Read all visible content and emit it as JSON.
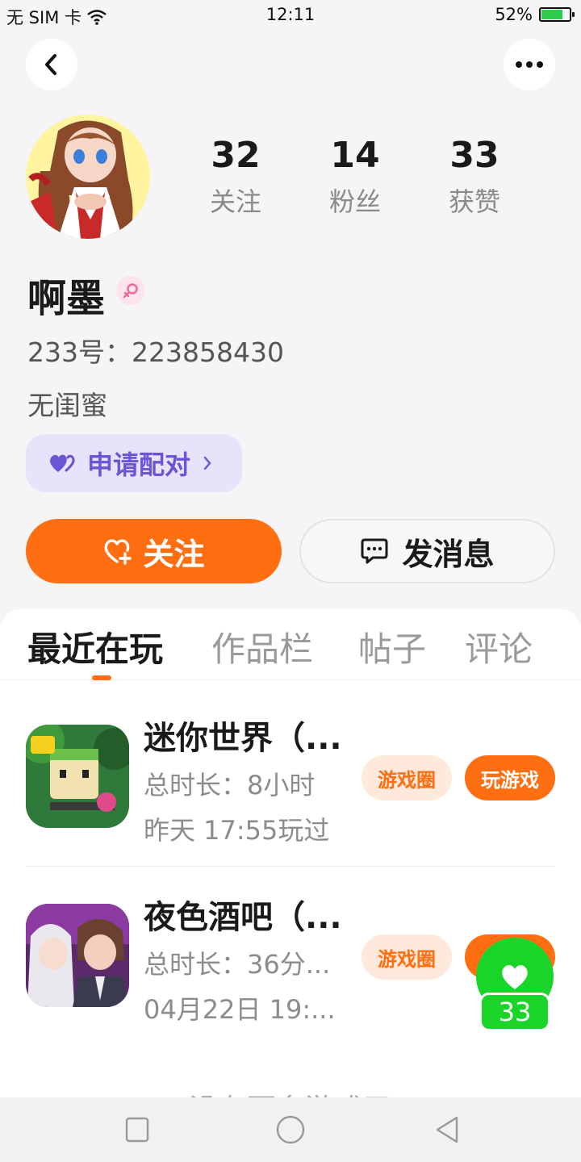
{
  "status_bar": {
    "carrier": "无 SIM 卡",
    "time": "12:11",
    "battery": "52%",
    "battery_level": 0.52,
    "icons": [
      "wifi-icon",
      "battery-icon"
    ]
  },
  "header": {
    "back_icon": "chevron-left-icon",
    "more_icon": "more-dots-icon"
  },
  "profile": {
    "avatar": "anime-girl-avatar",
    "stats": [
      {
        "value": "32",
        "label": "关注"
      },
      {
        "value": "14",
        "label": "粉丝"
      },
      {
        "value": "33",
        "label": "获赞"
      }
    ],
    "nickname": "啊墨",
    "gender_icon": "female-icon",
    "id_text": "233号：223858430",
    "bff_text": "无闺蜜",
    "pair_button": "申请配对",
    "follow_button": "关注",
    "message_button": "发消息"
  },
  "tabs": [
    {
      "label": "最近在玩",
      "active": true
    },
    {
      "label": "作品栏",
      "active": false
    },
    {
      "label": "帖子",
      "active": false
    },
    {
      "label": "评论",
      "active": false
    }
  ],
  "games": [
    {
      "title": "迷你世界（...",
      "duration": "总时长：8小时",
      "last_played": "昨天 17:55玩过",
      "circle_button": "游戏圈",
      "play_button": "玩游戏"
    },
    {
      "title": "夜色酒吧（...",
      "duration": "总时长：36分...",
      "last_played": "04月22日 19:...",
      "circle_button": "游戏圈",
      "play_button": ""
    }
  ],
  "footer_text": "没有更多游戏了",
  "floating_like": {
    "count": "33",
    "icon": "heart-icon"
  },
  "colors": {
    "accent": "#ff6f12",
    "pair_bg": "#e6e4fb",
    "pair_text": "#6b55d6",
    "like_green": "#1bd42a"
  }
}
